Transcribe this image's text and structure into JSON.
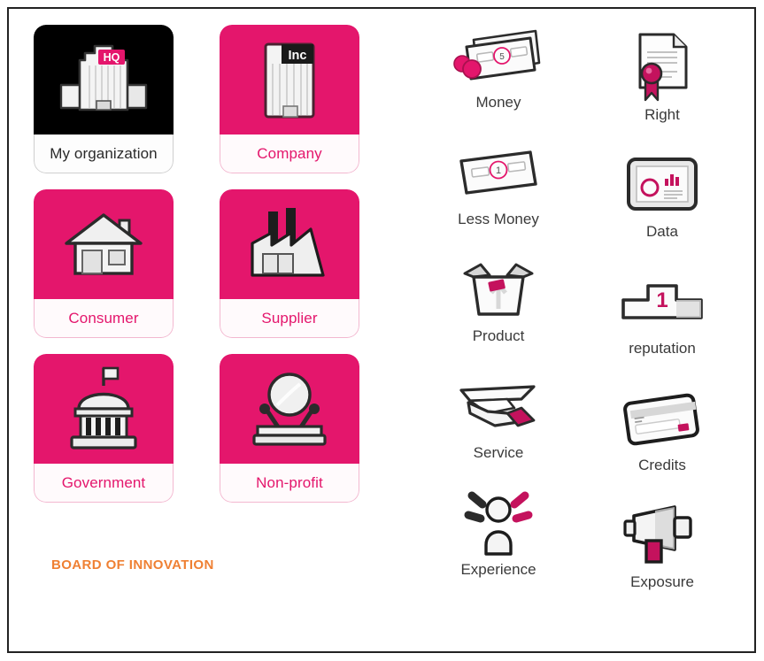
{
  "theme": {
    "pink": "#e4166c",
    "pink_deep": "#c4125d",
    "black": "#000000",
    "orange": "#ef8033",
    "label_gray": "#3a3a3a",
    "frame": "#222222",
    "background": "#ffffff"
  },
  "brand": {
    "text": "BOARD OF INNOVATION"
  },
  "actors": {
    "rows": [
      [
        {
          "label": "My organization",
          "icon": "headquarters-building-icon",
          "sign": "HQ",
          "variant": "dark"
        },
        {
          "label": "Company",
          "icon": "company-building-icon",
          "sign": "Inc",
          "variant": "pink"
        }
      ],
      [
        {
          "label": "Consumer",
          "icon": "house-icon",
          "sign": "",
          "variant": "pink"
        },
        {
          "label": "Supplier",
          "icon": "factory-icon",
          "sign": "",
          "variant": "pink"
        }
      ],
      [
        {
          "label": "Government",
          "icon": "capitol-dome-icon",
          "sign": "",
          "variant": "pink"
        },
        {
          "label": "Non-profit",
          "icon": "charity-globe-stand-icon",
          "sign": "",
          "variant": "pink"
        }
      ]
    ]
  },
  "values": {
    "items": [
      {
        "label": "Money",
        "icon": "banknotes-coins-icon",
        "denomination": "5",
        "column": "left"
      },
      {
        "label": "Right",
        "icon": "certificate-seal-icon",
        "denomination": "",
        "column": "right"
      },
      {
        "label": "Less Money",
        "icon": "single-banknote-icon",
        "denomination": "1",
        "column": "left"
      },
      {
        "label": "Data",
        "icon": "monitor-chart-icon",
        "denomination": "",
        "column": "right"
      },
      {
        "label": "Product",
        "icon": "open-box-icon",
        "denomination": "",
        "column": "left"
      },
      {
        "label": "reputation",
        "icon": "podium-first-place-icon",
        "denomination": "1",
        "column": "right"
      },
      {
        "label": "Service",
        "icon": "hand-serving-tray-icon",
        "denomination": "",
        "column": "left"
      },
      {
        "label": "Credits",
        "icon": "credit-card-icon",
        "denomination": "",
        "column": "right"
      },
      {
        "label": "Experience",
        "icon": "person-rays-icon",
        "denomination": "",
        "column": "left"
      },
      {
        "label": "Exposure",
        "icon": "megaphone-icon",
        "denomination": "",
        "column": "right"
      }
    ]
  }
}
